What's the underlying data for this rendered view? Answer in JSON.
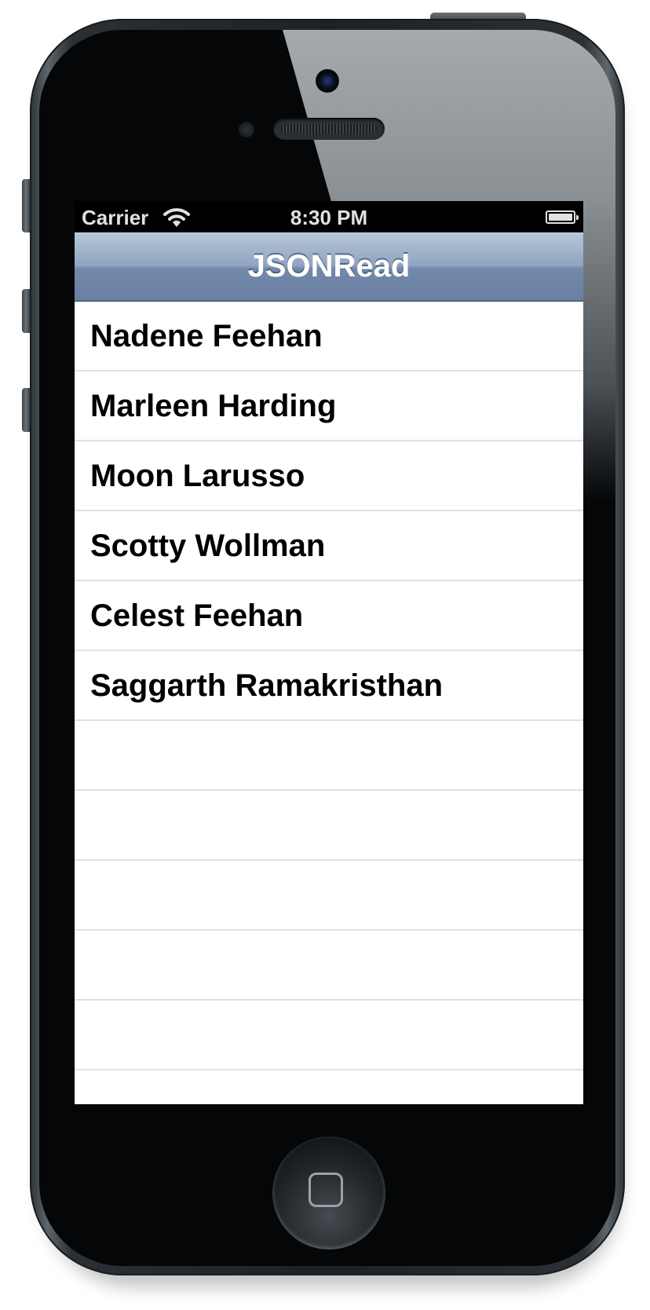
{
  "status_bar": {
    "carrier": "Carrier",
    "time": "8:30 PM",
    "wifi_icon": "wifi-icon",
    "battery_icon": "battery-icon"
  },
  "nav_bar": {
    "title": "JSONRead"
  },
  "table": {
    "rows": [
      {
        "label": "Nadene Feehan"
      },
      {
        "label": "Marleen Harding"
      },
      {
        "label": "Moon Larusso"
      },
      {
        "label": "Scotty Wollman"
      },
      {
        "label": "Celest Feehan"
      },
      {
        "label": "Saggarth Ramakristhan"
      },
      {
        "label": ""
      },
      {
        "label": ""
      },
      {
        "label": ""
      },
      {
        "label": ""
      },
      {
        "label": ""
      },
      {
        "label": ""
      }
    ]
  },
  "colors": {
    "nav_bar_top": "#b7c6d9",
    "nav_bar_bottom": "#6a7fa1",
    "separator": "#e0e0e0",
    "phone_body": "#040608"
  }
}
